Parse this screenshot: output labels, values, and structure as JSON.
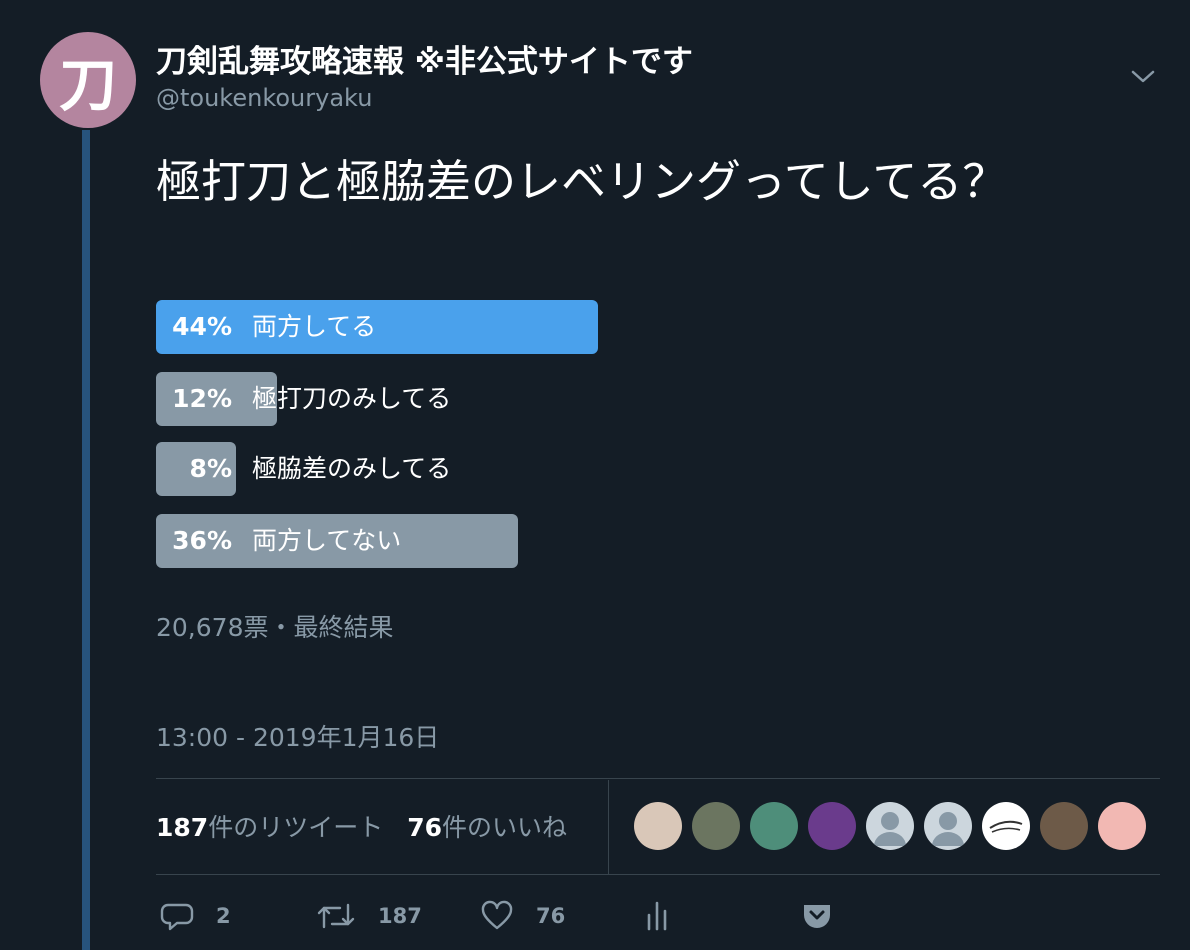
{
  "tweet": {
    "avatar_glyph": "刀",
    "display_name": "刀剣乱舞攻略速報 ※非公式サイトです",
    "handle": "@toukenkouryaku",
    "text": "極打刀と極脇差のレベリングってしてる？",
    "menu_icon": "chevron-down-icon"
  },
  "poll": {
    "options": [
      {
        "percent_label": "44%",
        "label": "両方してる",
        "percent": 44,
        "winner": true
      },
      {
        "percent_label": "12%",
        "label": "極打刀のみしてる",
        "percent": 12,
        "winner": false
      },
      {
        "percent_label": "8%",
        "label": "極脇差のみしてる",
        "percent": 8,
        "winner": false
      },
      {
        "percent_label": "36%",
        "label": "両方してない",
        "percent": 36,
        "winner": false
      }
    ],
    "footer": "20,678票・最終結果"
  },
  "timestamp": "13:00 - 2019年1月16日",
  "stats": {
    "retweets_count": "187",
    "retweets_label": "件のリツイート",
    "likes_count": "76",
    "likes_label": "件のいいね"
  },
  "likers": [
    {
      "name": "liker-avatar-1",
      "color": "#d9c7b8"
    },
    {
      "name": "liker-avatar-2",
      "color": "#6b7560"
    },
    {
      "name": "liker-avatar-3",
      "color": "#4e8e7a"
    },
    {
      "name": "liker-avatar-4",
      "color": "#6a3b8c"
    },
    {
      "name": "liker-avatar-5",
      "color": "#ccd6dd",
      "default": true
    },
    {
      "name": "liker-avatar-6",
      "color": "#ccd6dd",
      "default": true
    },
    {
      "name": "liker-avatar-7",
      "color": "#ffffff"
    },
    {
      "name": "liker-avatar-8",
      "color": "#6d5a48"
    },
    {
      "name": "liker-avatar-9",
      "color": "#f2b8b3"
    }
  ],
  "actions": {
    "reply": {
      "icon": "reply-icon",
      "count": "2"
    },
    "retweet": {
      "icon": "retweet-icon",
      "count": "187"
    },
    "like": {
      "icon": "heart-icon",
      "count": "76"
    },
    "analytics": {
      "icon": "analytics-icon"
    },
    "pocket": {
      "icon": "pocket-icon"
    }
  },
  "colors": {
    "background": "#141d26",
    "winner_bar": "#4aa1ec",
    "other_bar": "#8899a6",
    "thread_line": "#27537c",
    "avatar": "#b4859f"
  }
}
